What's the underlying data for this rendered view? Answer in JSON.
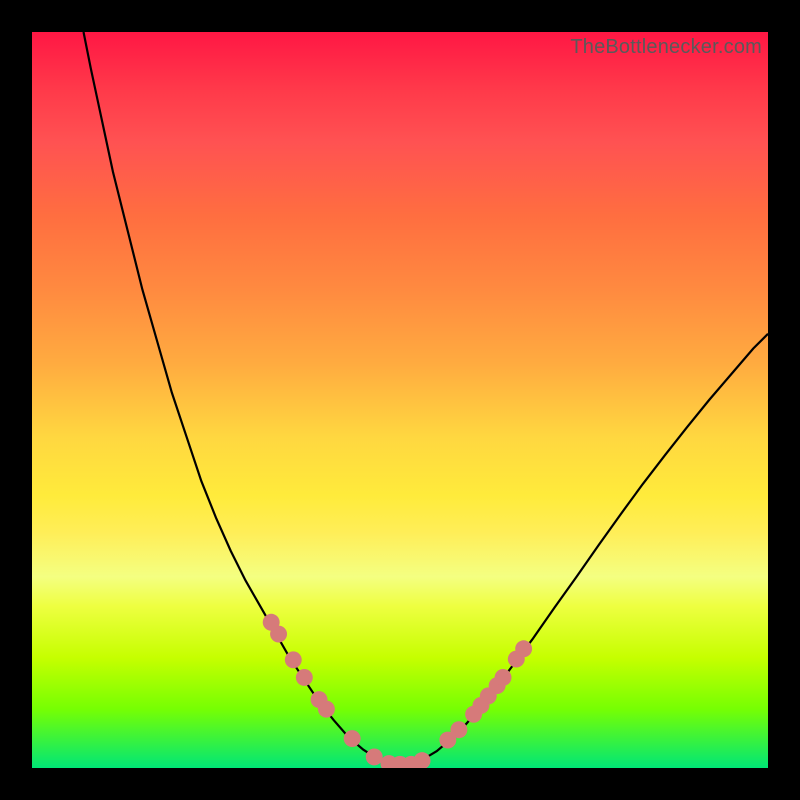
{
  "chart_data": {
    "type": "line",
    "title": "",
    "xlabel": "",
    "ylabel": "",
    "xlim": [
      0,
      100
    ],
    "ylim": [
      0,
      100
    ],
    "curve_points": [
      [
        7,
        100
      ],
      [
        8,
        95
      ],
      [
        9.5,
        88
      ],
      [
        11,
        81
      ],
      [
        13,
        73
      ],
      [
        15,
        65
      ],
      [
        17,
        58
      ],
      [
        19,
        51
      ],
      [
        21,
        45
      ],
      [
        23,
        39
      ],
      [
        25,
        34
      ],
      [
        27,
        29.5
      ],
      [
        29,
        25.5
      ],
      [
        31,
        22
      ],
      [
        33,
        18.5
      ],
      [
        35,
        15
      ],
      [
        37,
        12
      ],
      [
        39,
        9
      ],
      [
        41,
        6.5
      ],
      [
        43,
        4.2
      ],
      [
        45,
        2.5
      ],
      [
        47,
        1.2
      ],
      [
        49,
        0.5
      ],
      [
        51,
        0.5
      ],
      [
        53,
        1.1
      ],
      [
        55,
        2.3
      ],
      [
        57,
        4
      ],
      [
        59,
        6
      ],
      [
        61,
        8.3
      ],
      [
        63,
        10.8
      ],
      [
        65,
        13.5
      ],
      [
        68,
        17.5
      ],
      [
        71,
        21.8
      ],
      [
        74,
        26
      ],
      [
        77,
        30.3
      ],
      [
        80,
        34.5
      ],
      [
        83,
        38.6
      ],
      [
        86,
        42.5
      ],
      [
        89,
        46.3
      ],
      [
        92,
        50
      ],
      [
        95,
        53.5
      ],
      [
        98,
        57
      ],
      [
        100,
        59
      ]
    ],
    "dots": [
      [
        32.5,
        19.8
      ],
      [
        33.5,
        18.2
      ],
      [
        35.5,
        14.7
      ],
      [
        37,
        12.3
      ],
      [
        39,
        9.3
      ],
      [
        40,
        8
      ],
      [
        43.5,
        4
      ],
      [
        46.5,
        1.5
      ],
      [
        48.5,
        0.6
      ],
      [
        50,
        0.5
      ],
      [
        51.5,
        0.5
      ],
      [
        53,
        1
      ],
      [
        56.5,
        3.8
      ],
      [
        58,
        5.2
      ],
      [
        60,
        7.3
      ],
      [
        61,
        8.5
      ],
      [
        62,
        9.8
      ],
      [
        63.2,
        11.2
      ],
      [
        64,
        12.3
      ],
      [
        65.8,
        14.8
      ],
      [
        66.8,
        16.2
      ]
    ],
    "watermark": "TheBottlenecker.com"
  }
}
